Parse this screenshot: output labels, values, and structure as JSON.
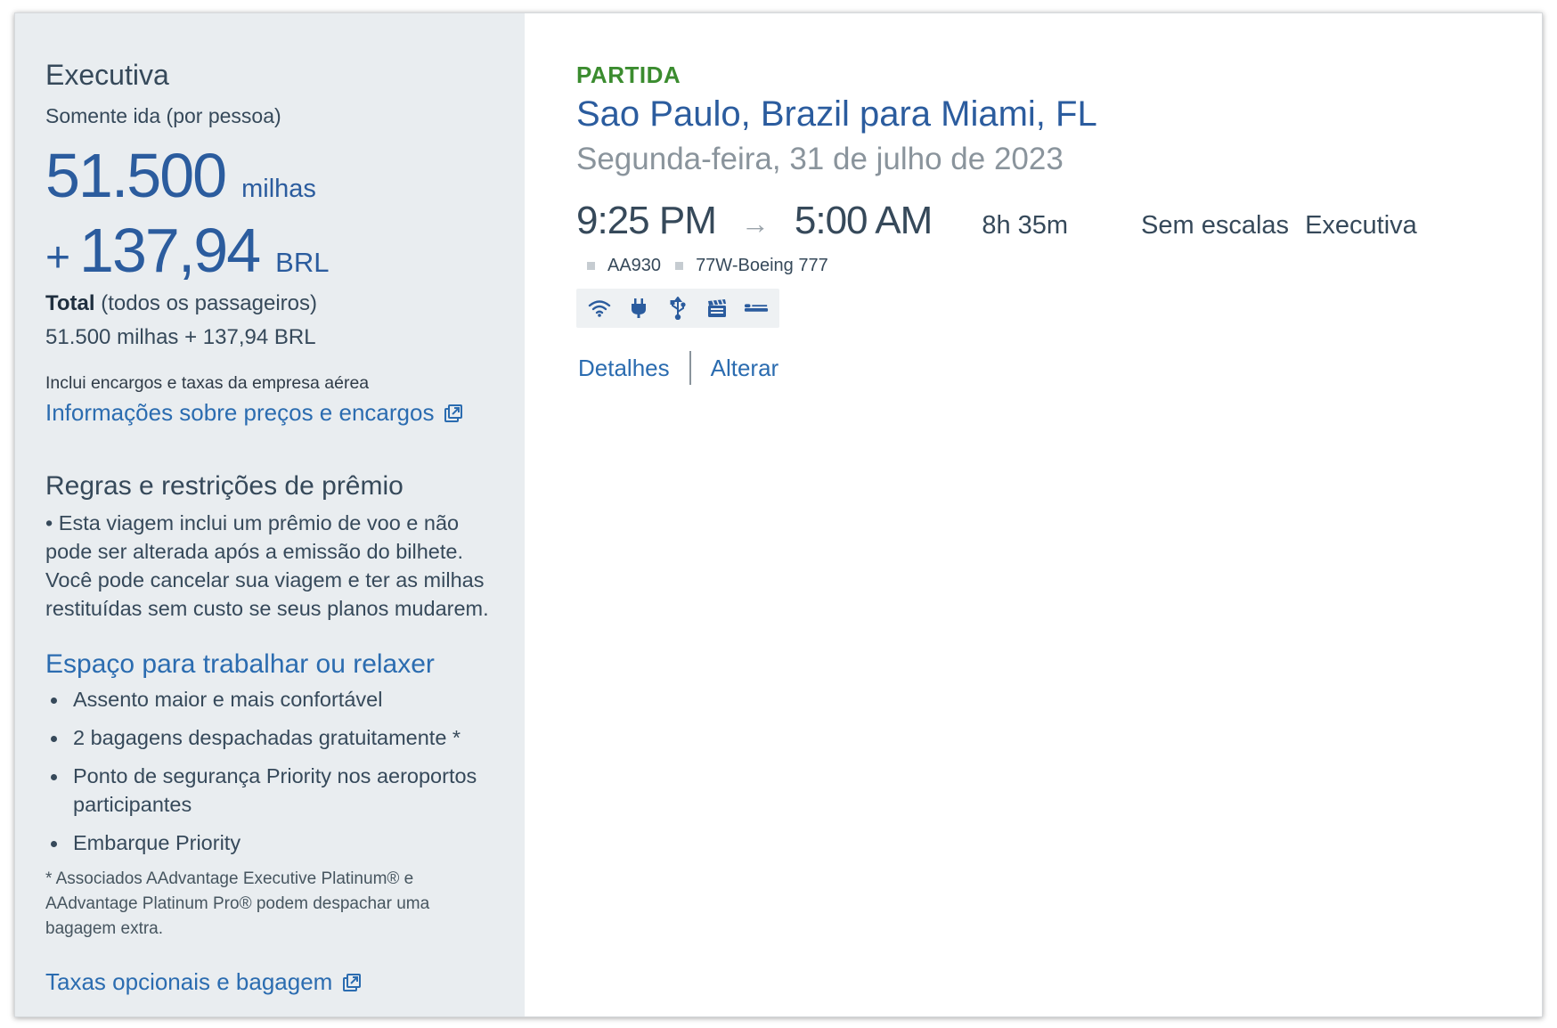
{
  "fare": {
    "cabin": "Executiva",
    "trip_type": "Somente ida (por pessoa)",
    "miles": "51.500",
    "miles_unit": "milhas",
    "plus": "+",
    "fee": "137,94",
    "fee_unit": "BRL",
    "total_label": "Total",
    "total_suffix": " (todos os passageiros)",
    "total_value": "51.500 milhas + 137,94 BRL",
    "includes_text": "Inclui encargos e taxas da empresa aérea",
    "info_link": "Informações sobre preços e encargos"
  },
  "rules": {
    "title": "Regras e restrições de prêmio",
    "text": "Esta viagem inclui um prêmio de voo e não pode ser alterada após a emissão do bilhete. Você pode cancelar sua viagem e ter as milhas restituídas sem custo se seus planos mudarem."
  },
  "benefits": {
    "title": "Espaço para trabalhar ou relaxer",
    "items": [
      "Assento maior e mais confortável",
      "2 bagagens despachadas gratuitamente *",
      "Ponto de segurança Priority nos aeroportos participantes",
      "Embarque Priority"
    ],
    "footnote": "* Associados AAdvantage Executive Platinum® e AAdvantage Platinum Pro® podem despachar uma bagagem extra.",
    "optional_link": "Taxas opcionais e bagagem"
  },
  "flight": {
    "direction": "PARTIDA",
    "route": "Sao Paulo, Brazil para Miami, FL",
    "date": "Segunda-feira, 31 de julho de 2023",
    "depart_time": "9:25 PM",
    "arrow": "→",
    "arrive_time": "5:00 AM",
    "duration": "8h 35m",
    "stops": "Sem escalas",
    "cabin": "Executiva",
    "flight_number": "AA930",
    "aircraft": "77W-Boeing 777",
    "amenities": [
      "wifi-icon",
      "power-outlet-icon",
      "usb-icon",
      "entertainment-icon",
      "lie-flat-seat-icon"
    ],
    "details_link": "Detalhes",
    "change_link": "Alterar"
  },
  "colors": {
    "accent_blue": "#2b6cb0",
    "price_blue": "#2b5c9e",
    "departure_green": "#3b8c2f",
    "panel_gray": "#e9edf0"
  }
}
